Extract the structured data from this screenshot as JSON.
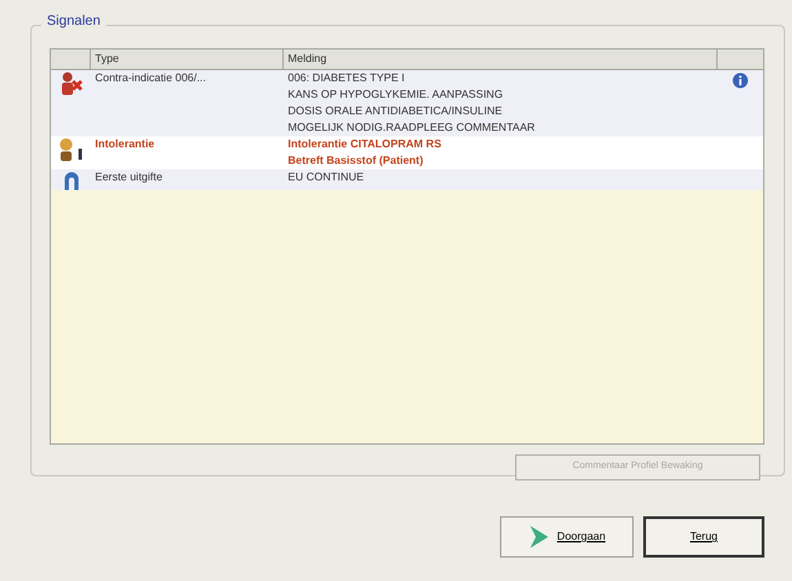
{
  "group": {
    "title": "Signalen"
  },
  "table": {
    "columns": [
      "Type",
      "Melding"
    ],
    "rows": [
      {
        "kind": "contra",
        "type": "Contra-indicatie 006/...",
        "lines": [
          "006: DIABETES TYPE I",
          "KANS OP HYPOGLYKEMIE. AANPASSING",
          "DOSIS ORALE ANTIDIABETICA/INSULINE",
          "MOGELIJK NODIG.RAADPLEEG COMMENTAAR"
        ],
        "highlighted": false,
        "info": true
      },
      {
        "kind": "intolerance",
        "type": "Intolerantie",
        "lines": [
          "Intolerantie CITALOPRAM RS",
          "Betreft Basisstof (Patient)"
        ],
        "highlighted": true,
        "info": false
      },
      {
        "kind": "first",
        "type": "Eerste uitgifte",
        "lines": [
          "EU CONTINUE"
        ],
        "highlighted": false,
        "info": false
      }
    ]
  },
  "comment_button": {
    "label": "Commentaar Profiel Bewaking",
    "disabled": true
  },
  "buttons": [
    {
      "kind": "proceed",
      "label": "Doorgaan"
    },
    {
      "kind": "back",
      "label": "Terug"
    }
  ]
}
